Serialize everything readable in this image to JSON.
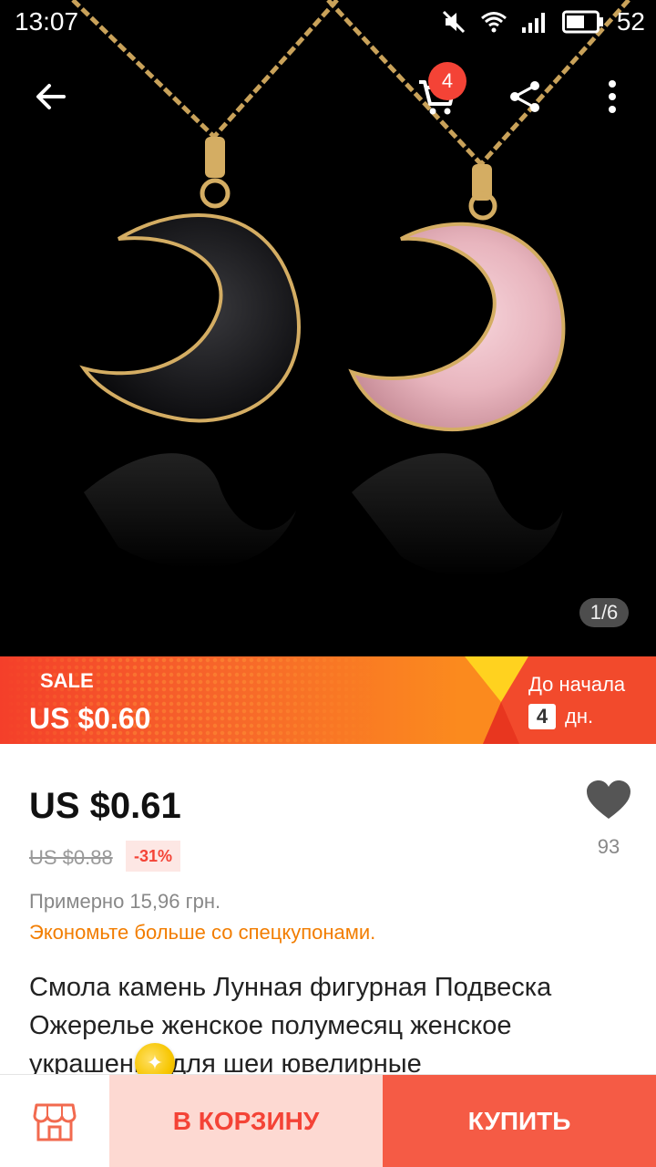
{
  "status_bar": {
    "time": "13:07",
    "battery": "52"
  },
  "toolbar": {
    "cart_count": "4"
  },
  "gallery": {
    "indicator": "1/6"
  },
  "sale_banner": {
    "label": "SALE",
    "price": "US $0.60",
    "countdown_label": "До начала",
    "countdown_value": "4",
    "countdown_unit": "дн."
  },
  "product": {
    "price": "US $0.61",
    "old_price": "US $0.88",
    "discount": "-31%",
    "wishlist_count": "93",
    "approx_price": "Примерно 15,96 грн.",
    "coupon_text": "Экономьте больше со спецкупонами.",
    "title": "Смола камень Лунная фигурная Подвеска Ожерелье женское полумесяц женское украшение для шеи ювелирные"
  },
  "actions": {
    "add_to_cart": "В КОРЗИНУ",
    "buy_now": "КУПИТЬ"
  },
  "colors": {
    "accent_red": "#f44336",
    "buy_button": "#f55b45",
    "cart_button_bg": "#fdd9d2",
    "coupon_orange": "#f27d00"
  }
}
